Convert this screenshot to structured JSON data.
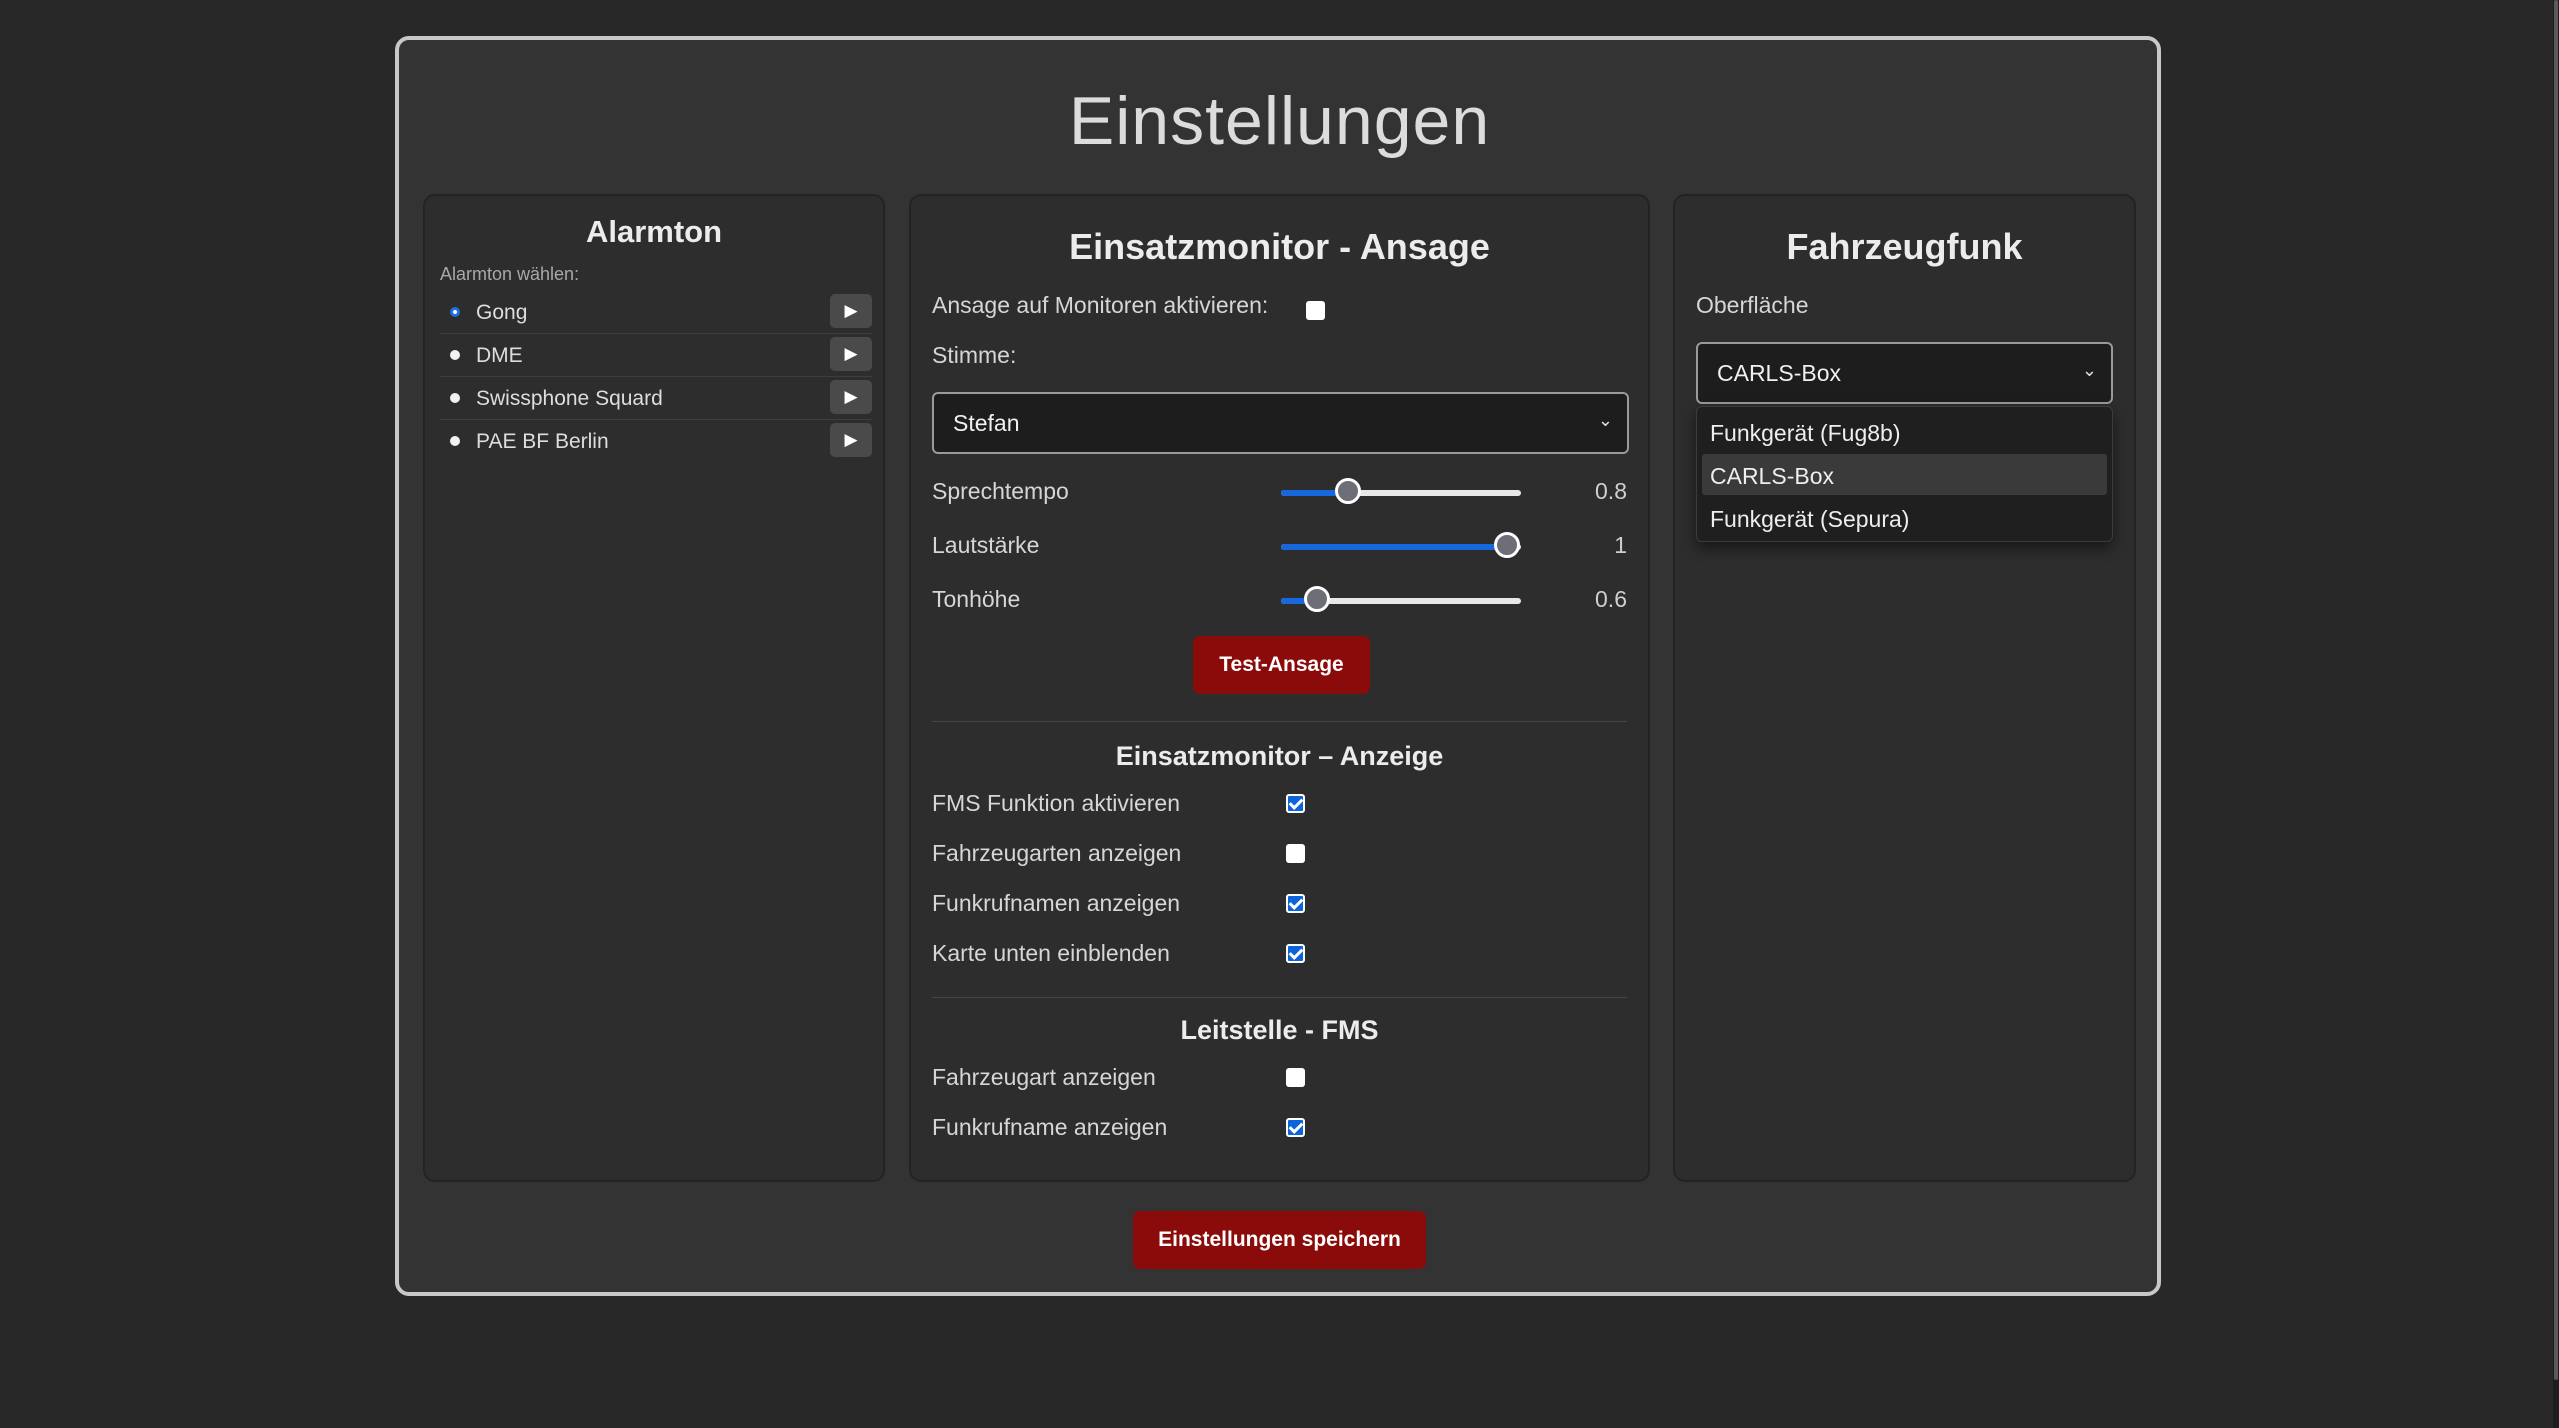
{
  "page": {
    "title": "Einstellungen"
  },
  "alarmton": {
    "title": "Alarmton",
    "subtitle": "Alarmton wählen:",
    "play_icon": "▶",
    "items": [
      {
        "label": "Gong",
        "selected": true
      },
      {
        "label": "DME",
        "selected": false
      },
      {
        "label": "Swissphone Squard",
        "selected": false
      },
      {
        "label": "PAE BF Berlin",
        "selected": false
      }
    ]
  },
  "ansage": {
    "title": "Einsatzmonitor - Ansage",
    "activate_label": "Ansage auf Monitoren aktivieren:",
    "activate_checked": false,
    "voice_label": "Stimme:",
    "voice_value": "Stefan",
    "sliders": [
      {
        "label": "Sprechtempo",
        "value": "0.8",
        "fraction": 0.28
      },
      {
        "label": "Lautstärke",
        "value": "1",
        "fraction": 0.94
      },
      {
        "label": "Tonhöhe",
        "value": "0.6",
        "fraction": 0.15
      }
    ],
    "test_button": "Test-Ansage"
  },
  "anzeige": {
    "title": "Einsatzmonitor – Anzeige",
    "options": [
      {
        "label": "FMS Funktion aktivieren",
        "checked": true
      },
      {
        "label": "Fahrzeugarten anzeigen",
        "checked": false
      },
      {
        "label": "Funkrufnamen anzeigen",
        "checked": true
      },
      {
        "label": "Karte unten einblenden",
        "checked": true
      }
    ]
  },
  "leitstelle": {
    "title": "Leitstelle - FMS",
    "options": [
      {
        "label": "Fahrzeugart anzeigen",
        "checked": false
      },
      {
        "label": "Funkrufname anzeigen",
        "checked": true
      }
    ]
  },
  "fahrzeugfunk": {
    "title": "Fahrzeugfunk",
    "surface_label": "Oberfläche",
    "surface_value": "CARLS-Box",
    "options": [
      {
        "label": "Funkgerät (Fug8b)",
        "highlighted": false
      },
      {
        "label": "CARLS-Box",
        "highlighted": true
      },
      {
        "label": "Funkgerät (Sepura)",
        "highlighted": false
      }
    ]
  },
  "save_button": "Einstellungen speichern",
  "colors": {
    "accent_red": "#8b0b0b",
    "accent_blue": "#1668dc",
    "background": "#282828",
    "card": "#333333"
  }
}
